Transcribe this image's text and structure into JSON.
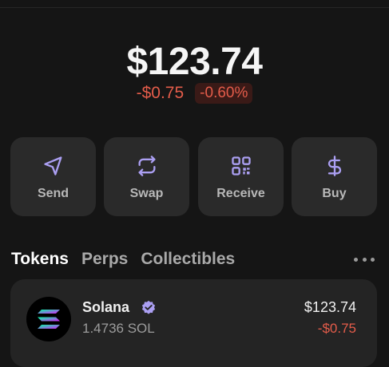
{
  "balance": {
    "total": "$123.74",
    "change_amount": "-$0.75",
    "change_percent": "-0.60%"
  },
  "actions": [
    {
      "label": "Send",
      "icon": "send-icon"
    },
    {
      "label": "Swap",
      "icon": "swap-icon"
    },
    {
      "label": "Receive",
      "icon": "qr-code-icon"
    },
    {
      "label": "Buy",
      "icon": "dollar-icon"
    }
  ],
  "tabs": [
    {
      "label": "Tokens",
      "active": true
    },
    {
      "label": "Perps",
      "active": false
    },
    {
      "label": "Collectibles",
      "active": false
    }
  ],
  "token": {
    "name": "Solana",
    "amount": "1.4736 SOL",
    "value": "$123.74",
    "change": "-$0.75",
    "icon": "solana-logo",
    "verified": true
  },
  "colors": {
    "background": "#151515",
    "card": "#2a2a2a",
    "accent": "#ab9ff2",
    "negative": "#e45c4a"
  }
}
